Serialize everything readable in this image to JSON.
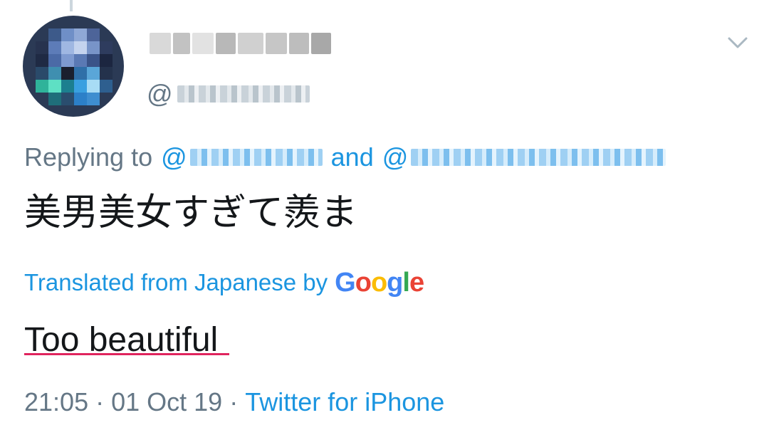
{
  "tweet": {
    "handle_prefix": "@",
    "replying_to": "Replying to",
    "mention_prefix": "@",
    "and": "and",
    "text": "美男美女すぎて羨ま",
    "translated_label": "Translated from Japanese by",
    "translator": {
      "g1": "G",
      "o1": "o",
      "o2": "o",
      "g2": "g",
      "l": "l",
      "e": "e"
    },
    "translation": "Too beautiful",
    "time": "21:05",
    "separator": "·",
    "date": "01 Oct 19",
    "source": "Twitter for iPhone"
  },
  "icons": {
    "menu": "chevron-down-icon",
    "avatar": "blurred-avatar"
  },
  "colors": {
    "link": "#1b95e0",
    "secondary": "#657786",
    "text": "#14171a",
    "underline": "#e0245e"
  }
}
